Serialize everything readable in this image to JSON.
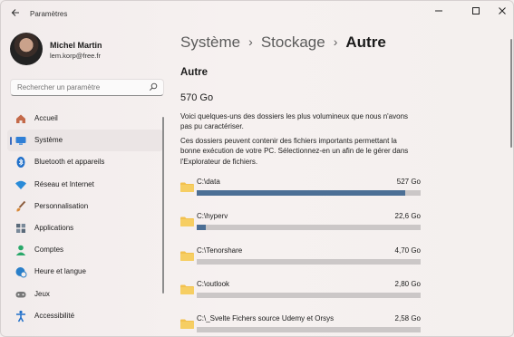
{
  "titlebar": {
    "back_icon": "arrow-left-icon",
    "title": "Paramètres",
    "minimize_icon": "minimize-icon",
    "maximize_icon": "maximize-icon",
    "close_icon": "close-icon"
  },
  "profile": {
    "name": "Michel Martin",
    "email": "lem.korp@free.fr"
  },
  "search": {
    "placeholder": "Rechercher un paramètre",
    "icon": "search-icon"
  },
  "sidebar": {
    "items": [
      {
        "label": "Accueil",
        "icon": "home-icon",
        "color": "#c46a4a"
      },
      {
        "label": "Système",
        "icon": "monitor-icon",
        "color": "#2f7fd6",
        "active": true
      },
      {
        "label": "Bluetooth et appareils",
        "icon": "bluetooth-icon",
        "color": "#1f6fc9"
      },
      {
        "label": "Réseau et Internet",
        "icon": "wifi-icon",
        "color": "#2a8bd8"
      },
      {
        "label": "Personnalisation",
        "icon": "brush-icon",
        "color": "#d98a3a"
      },
      {
        "label": "Applications",
        "icon": "apps-icon",
        "color": "#5a6a7a"
      },
      {
        "label": "Comptes",
        "icon": "person-icon",
        "color": "#2aa86a"
      },
      {
        "label": "Heure et langue",
        "icon": "globe-clock-icon",
        "color": "#2a7fc9"
      },
      {
        "label": "Jeux",
        "icon": "gamepad-icon",
        "color": "#777777"
      },
      {
        "label": "Accessibilité",
        "icon": "accessibility-icon",
        "color": "#1f6fc9"
      }
    ]
  },
  "breadcrumb": {
    "items": [
      "Système",
      "Stockage"
    ],
    "current": "Autre"
  },
  "main": {
    "title": "Autre",
    "total": "570 Go",
    "desc1": "Voici quelques-uns des dossiers les plus volumineux que nous n'avons pas pu caractériser.",
    "desc2": "Ces dossiers peuvent contenir des fichiers importants permettant la bonne exécution de votre PC. Sélectionnez-en un afin de le gérer dans l'Explorateur de fichiers."
  },
  "folders": [
    {
      "name": "C:\\data",
      "size": "527 Go",
      "fill": 0.93
    },
    {
      "name": "C:\\hyperv",
      "size": "22,6 Go",
      "fill": 0.04
    },
    {
      "name": "C:\\Tenorshare",
      "size": "4,70 Go",
      "fill": 0
    },
    {
      "name": "C:\\outlook",
      "size": "2,80 Go",
      "fill": 0
    },
    {
      "name": "C:\\_Svelte Fichers source Udemy et Orsys",
      "size": "2,58 Go",
      "fill": 0
    }
  ],
  "colors": {
    "accent": "#3c6cbf",
    "bar_fill": "#4c6f95",
    "bar_track": "#cbc7c7",
    "folder": "#f2c14e"
  }
}
